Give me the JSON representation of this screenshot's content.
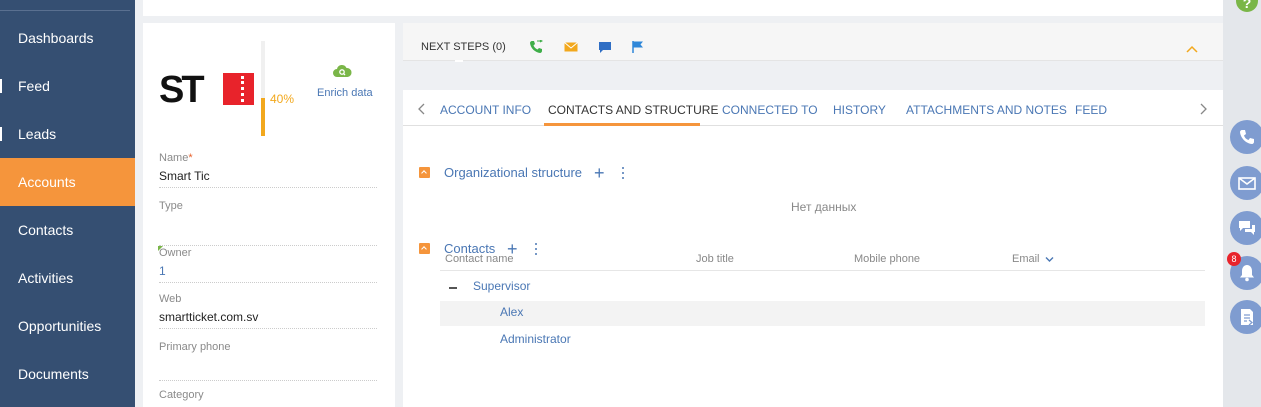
{
  "sidebar": {
    "items": [
      {
        "label": "Dashboards"
      },
      {
        "label": "Feed"
      },
      {
        "label": "Leads"
      },
      {
        "label": "Accounts",
        "active": true
      },
      {
        "label": "Contacts"
      },
      {
        "label": "Activities"
      },
      {
        "label": "Opportunities"
      },
      {
        "label": "Documents"
      }
    ]
  },
  "account": {
    "completeness": "40%",
    "completeness_value": 0.4,
    "enrich_label": "Enrich data",
    "fields": {
      "name_label": "Name",
      "name_required": "*",
      "name_value": "Smart Tic",
      "type_label": "Type",
      "type_value": "",
      "owner_label": "Owner",
      "owner_value": "1",
      "web_label": "Web",
      "web_value": "smartticket.com.sv",
      "phone_label": "Primary phone",
      "phone_value": "",
      "category_label": "Category"
    }
  },
  "next_steps": {
    "label": "NEXT STEPS (0)"
  },
  "tabs": [
    {
      "label": "ACCOUNT INFO"
    },
    {
      "label": "CONTACTS AND STRUCTURE",
      "active": true
    },
    {
      "label": "CONNECTED TO"
    },
    {
      "label": "HISTORY"
    },
    {
      "label": "ATTACHMENTS AND NOTES"
    },
    {
      "label": "FEED"
    }
  ],
  "org_structure": {
    "title": "Organizational structure",
    "plus": "+",
    "empty_text": "Нет данных"
  },
  "contacts": {
    "title": "Contacts",
    "plus": "+",
    "columns": [
      "Contact name",
      "Job title",
      "Mobile phone",
      "Email"
    ],
    "group": "Supervisor",
    "rows": [
      "Alex",
      "Administrator"
    ]
  },
  "rail": {
    "help": "?",
    "notifications_count": "8"
  },
  "colors": {
    "sidebar": "#354f72",
    "accent": "#f5953c",
    "link": "#4a77b4",
    "progress": "#f2a81d",
    "rail_button": "#7f9cd0"
  }
}
